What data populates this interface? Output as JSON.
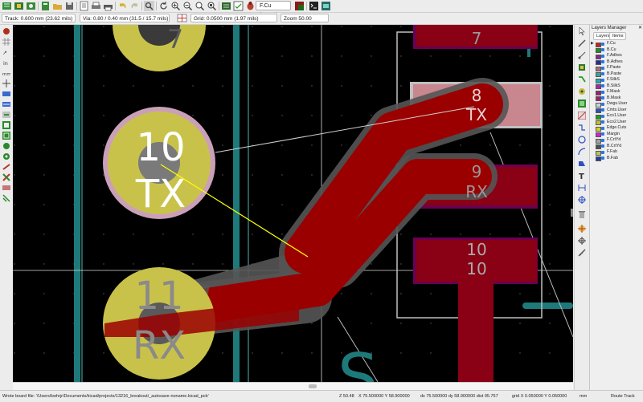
{
  "toolbar": {
    "layer_select": "F.Cu (PgUp)",
    "icons": [
      "board-setup-icon",
      "module-editor-icon",
      "module-viewer-icon",
      "new-icon",
      "open-icon",
      "save-icon",
      "page-settings-icon",
      "print-icon",
      "plot-icon",
      "undo-icon",
      "redo-icon",
      "find-icon",
      "redraw-icon",
      "zoom-in-icon",
      "zoom-out-icon",
      "zoom-fit-icon",
      "zoom-selection-icon",
      "netlist-icon",
      "drc-icon",
      "autoroute-icon",
      "layer-pair-icon",
      "script-icon",
      "3d-viewer-icon"
    ]
  },
  "options": {
    "track": "Track: 0.600 mm (23.62 mils)",
    "via": "Via: 0.80 / 0.40 mm (31.5 / 15.7 mils)",
    "grid": "Grid: 0.0500 mm (1.97 mils)",
    "zoom": "Zoom 50.00"
  },
  "canvas": {
    "pads": [
      {
        "number": "7",
        "name": ""
      },
      {
        "number": "10",
        "name": "TX"
      },
      {
        "number": "11",
        "name": "RX"
      },
      {
        "number": "8",
        "name": "TX"
      },
      {
        "number": "9",
        "name": "RX"
      },
      {
        "number": "10",
        "name": "10"
      }
    ],
    "ref_text": "S"
  },
  "layers_manager": {
    "title": "Layers Manager",
    "tabs": [
      "Layers",
      "Items"
    ],
    "active_tab": "Layers",
    "layers": [
      {
        "name": "F.Cu",
        "color": "#cc2020"
      },
      {
        "name": "B.Cu",
        "color": "#209020"
      },
      {
        "name": "F.Adhes",
        "color": "#8a2a8a"
      },
      {
        "name": "B.Adhes",
        "color": "#2a2a9a"
      },
      {
        "name": "F.Paste",
        "color": "#b07070"
      },
      {
        "name": "B.Paste",
        "color": "#40a0a0"
      },
      {
        "name": "F.SilkS",
        "color": "#20b0b0"
      },
      {
        "name": "B.SilkS",
        "color": "#b020b0"
      },
      {
        "name": "F.Mask",
        "color": "#a02070"
      },
      {
        "name": "B.Mask",
        "color": "#a02070"
      },
      {
        "name": "Dwgs.User",
        "color": "#d0d0d0"
      },
      {
        "name": "Cmts.User",
        "color": "#3050c0"
      },
      {
        "name": "Eco1.User",
        "color": "#20a020"
      },
      {
        "name": "Eco2.User",
        "color": "#c0c020"
      },
      {
        "name": "Edge.Cuts",
        "color": "#d0d020"
      },
      {
        "name": "Margin",
        "color": "#d020d0"
      },
      {
        "name": "F.CrtYd",
        "color": "#a0a0a0"
      },
      {
        "name": "B.CrtYd",
        "color": "#505050"
      },
      {
        "name": "F.Fab",
        "color": "#c0c060"
      },
      {
        "name": "B.Fab",
        "color": "#2040a0"
      }
    ]
  },
  "status": {
    "message": "Wrote board file: '/Users/kwhrjr/Documents/kicad/projects/13216_breakout/_autosave-noname.kicad_pcb'",
    "z": "Z 50.48",
    "xy": "X 75.500000  Y 58.900000",
    "delta": "dx 75.500000  dy 58.900000  dist 95.757",
    "grid": "grid X 0.050000  Y 0.050000",
    "units": "mm",
    "mode": "Route Track"
  },
  "colors": {
    "track": "#9b0000",
    "pad_yellow": "#c9c24a",
    "pad_pink": "#c8868e",
    "mask": "#6a0050",
    "courtyard": "#1e7a7a",
    "ratsnest": "#ffff00"
  }
}
